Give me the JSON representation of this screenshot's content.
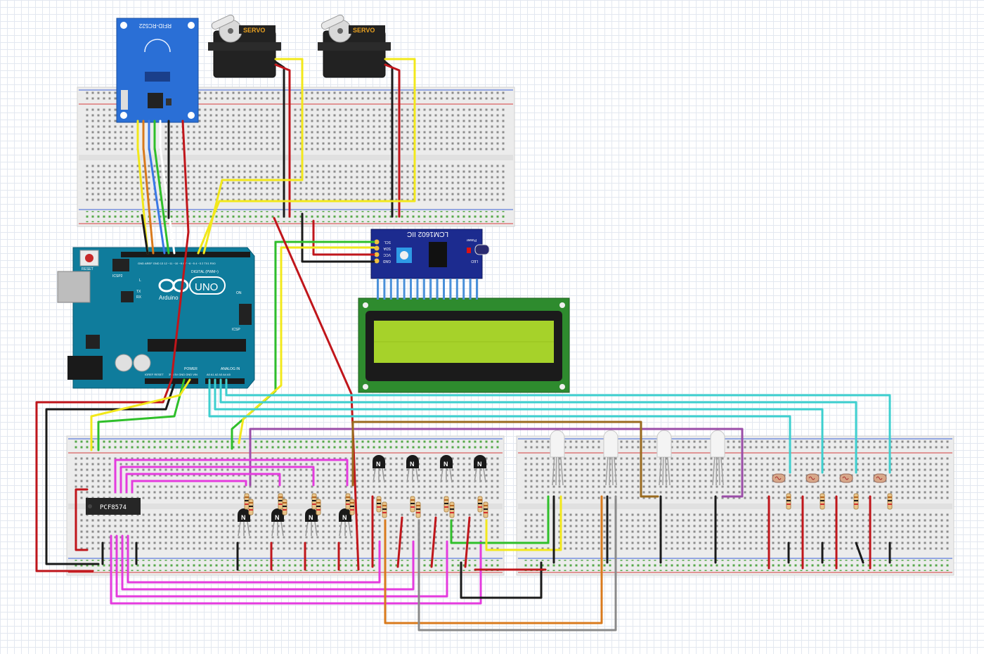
{
  "rfid": {
    "label": "RFID-RC522"
  },
  "servos": [
    {
      "label": "SERVO"
    },
    {
      "label": "SERVO"
    }
  ],
  "arduino": {
    "brand": "Arduino",
    "model": "UNO",
    "reset_label": "RESET",
    "icsp_label": "ICSP2",
    "icsp_right": "ICSP",
    "digital_label": "DIGITAL (PWM~)",
    "power_label": "POWER",
    "analog_label": "ANALOG IN",
    "on_label": "ON",
    "l_label": "L",
    "tx_label": "TX",
    "rx_label": "RX",
    "aref_gnd": "GND",
    "ioref_reset": "IOREF RESET",
    "pins_top": "AREF GND 13 12 ~11 ~10 ~9 8   7 ~6 ~5 4 ~3 2 TX1 RX0",
    "pins_power": "3V3 5V GND GND VIN",
    "pins_analog": "A0 A1 A2 A3 A4 A5"
  },
  "lcd_module": {
    "label": "LCM1602 IIC",
    "pins": [
      "SCL",
      "SDA",
      "VCC",
      "GND"
    ],
    "power_label": "Power",
    "led_label": "LED"
  },
  "pcf": {
    "label": "PCF8574"
  },
  "transistor_mark": "N",
  "colors": {
    "red": "#c0161b",
    "black": "#1a1a1a",
    "yellow": "#f2e81b",
    "green": "#2fbf2a",
    "blue": "#3a78e6",
    "orange": "#d97a1c",
    "magenta": "#e43bde",
    "cyan": "#3ecfcf",
    "purple": "#9b4da8",
    "brown": "#9a6a1e",
    "gray": "#8a8a8a",
    "white": "#ffffff"
  }
}
